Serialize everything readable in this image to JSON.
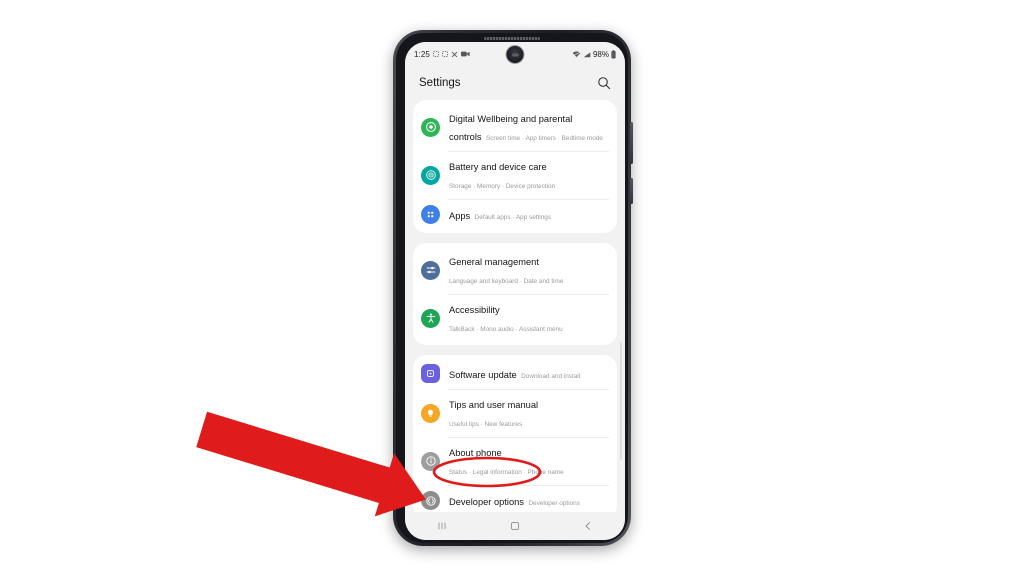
{
  "device": {
    "name": "android-phone",
    "frame_color": "#2c2e36"
  },
  "status_bar": {
    "clock": "1:25",
    "left_icons": [
      "placeholder-icon",
      "placeholder-icon",
      "no-sim-icon",
      "screen-recorder-icon"
    ],
    "right_icons": [
      "wifi-icon",
      "signal-icon"
    ],
    "battery_percent": "98%",
    "battery_icon": "battery-icon"
  },
  "header": {
    "title": "Settings",
    "search_icon": "search-icon"
  },
  "groups": [
    {
      "id": "group-1",
      "items": [
        {
          "id": "digital-wellbeing",
          "title": "Digital Wellbeing and parental controls",
          "subtitle": "Screen time  ·  App timers  ·  Bedtime mode",
          "icon": "digital-wellbeing-icon",
          "icon_color": "#2fb457"
        },
        {
          "id": "battery-device-care",
          "title": "Battery and device care",
          "subtitle": "Storage  ·  Memory  ·  Device protection",
          "icon": "battery-care-icon",
          "icon_color": "#00a6a0"
        },
        {
          "id": "apps",
          "title": "Apps",
          "subtitle": "Default apps  ·  App settings",
          "icon": "apps-grid-icon",
          "icon_color": "#3f7fe8"
        }
      ]
    },
    {
      "id": "group-2",
      "items": [
        {
          "id": "general-management",
          "title": "General management",
          "subtitle": "Language and keyboard  ·  Date and time",
          "icon": "sliders-icon",
          "icon_color": "#4e6e9c"
        },
        {
          "id": "accessibility",
          "title": "Accessibility",
          "subtitle": "TalkBack  ·  Mono audio  ·  Assistant menu",
          "icon": "accessibility-person-icon",
          "icon_color": "#1ea555"
        }
      ]
    },
    {
      "id": "group-3",
      "items": [
        {
          "id": "software-update",
          "title": "Software update",
          "subtitle": "Download and install",
          "icon": "software-update-icon",
          "icon_color": "#6b61e0"
        },
        {
          "id": "tips-user-manual",
          "title": "Tips and user manual",
          "subtitle": "Useful tips  ·  New features",
          "icon": "lightbulb-icon",
          "icon_color": "#f6a623"
        },
        {
          "id": "about-phone",
          "title": "About phone",
          "subtitle": "Status  ·  Legal information  ·  Phone name",
          "icon": "info-icon",
          "icon_color": "#9e9e9e"
        },
        {
          "id": "developer-options",
          "title": "Developer options",
          "subtitle": "Developer options",
          "icon": "developer-options-icon",
          "icon_color": "#8d8d8d"
        }
      ]
    }
  ],
  "nav_bar": {
    "recents_icon": "recents-icon",
    "home_icon": "home-icon",
    "back_icon": "back-icon"
  },
  "annotation": {
    "highlight_color": "#e01b1b",
    "arrow": "red-arrow-pointer",
    "ellipse": "red-ellipse-highlight",
    "target": "developer-options"
  }
}
